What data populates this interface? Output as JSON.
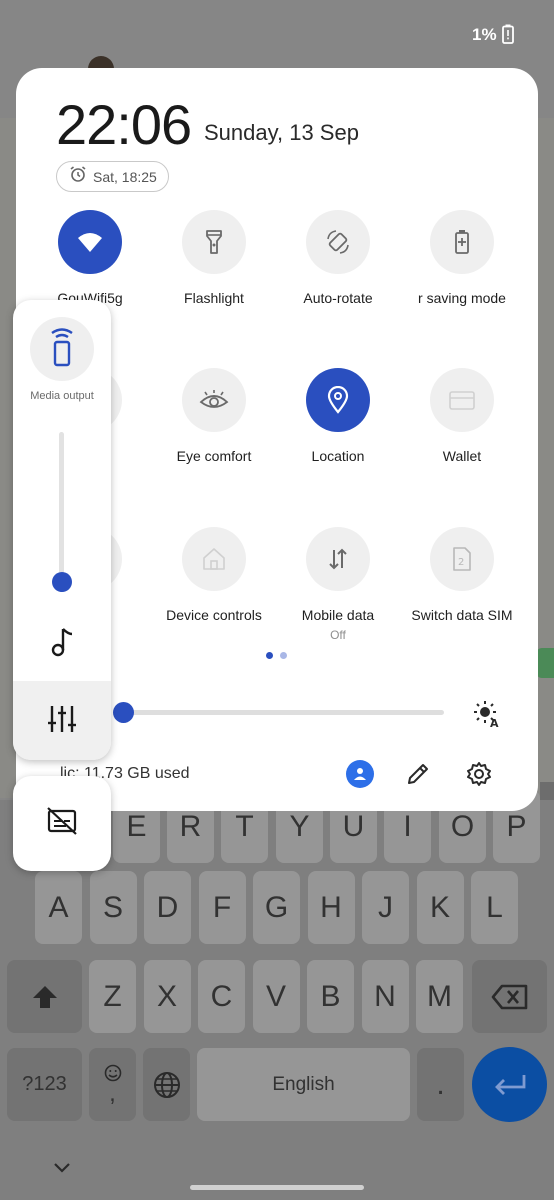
{
  "status_bar": {
    "battery": "1%"
  },
  "header": {
    "time": "22:06",
    "date": "Sunday, 13 Sep",
    "alarm": "Sat, 18:25"
  },
  "tiles": [
    {
      "label": "GouWifi5g",
      "sub": "",
      "icon": "wifi-icon",
      "active": true
    },
    {
      "label": "Flashlight",
      "sub": "",
      "icon": "flashlight-icon",
      "active": false
    },
    {
      "label": "Auto-rotate",
      "sub": "",
      "icon": "auto-rotate-icon",
      "active": false
    },
    {
      "label": "r saving mode",
      "sub": "",
      "icon": "battery-saver-icon",
      "active": false
    },
    {
      "label": "mode",
      "sub": "",
      "icon": "mode-icon",
      "active": false
    },
    {
      "label": "Eye comfort",
      "sub": "",
      "icon": "eye-icon",
      "active": false
    },
    {
      "label": "Location",
      "sub": "",
      "icon": "location-icon",
      "active": true
    },
    {
      "label": "Wallet",
      "sub": "",
      "icon": "wallet-icon",
      "active": false
    },
    {
      "label": "th",
      "sub": "",
      "icon": "bluetooth-icon",
      "active": false
    },
    {
      "label": "Device controls",
      "sub": "",
      "icon": "home-icon",
      "active": false
    },
    {
      "label": "Mobile data",
      "sub": "Off",
      "icon": "mobile-data-icon",
      "active": false
    },
    {
      "label": "Switch data SIM",
      "sub": "",
      "icon": "sim-icon",
      "active": false
    }
  ],
  "pager": {
    "pages": 2,
    "current": 1
  },
  "brightness": {
    "level": 0.0
  },
  "footer": {
    "storage": "lic: 11.73 GB used"
  },
  "volume_panel": {
    "media_output_label": "Media output",
    "level": 0.06
  },
  "keyboard": {
    "row1": [
      "E",
      "R",
      "T",
      "Y",
      "U",
      "I",
      "O",
      "P"
    ],
    "row2": [
      "A",
      "S",
      "D",
      "F",
      "G",
      "H",
      "J",
      "K",
      "L"
    ],
    "row3": [
      "Z",
      "X",
      "C",
      "V",
      "B",
      "N",
      "M"
    ],
    "symbols_key": "?123",
    "emoji_comma": ",",
    "space_label": "English",
    "period": "."
  },
  "colors": {
    "accent": "#2a4fbf",
    "panel": "#ffffff",
    "tile_off": "#efefef"
  }
}
